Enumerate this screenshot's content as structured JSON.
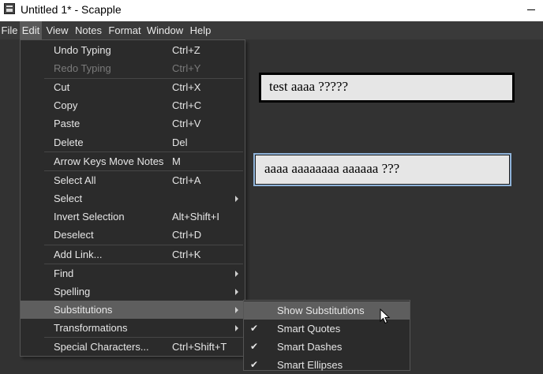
{
  "window": {
    "title": "Untitled 1* - Scapple"
  },
  "menubar": {
    "items": [
      {
        "label": "File"
      },
      {
        "label": "Edit"
      },
      {
        "label": "View"
      },
      {
        "label": "Notes"
      },
      {
        "label": "Format"
      },
      {
        "label": "Window"
      },
      {
        "label": "Help"
      }
    ]
  },
  "edit_menu": {
    "items": [
      {
        "label": "Undo Typing",
        "shortcut": "Ctrl+Z"
      },
      {
        "label": "Redo Typing",
        "shortcut": "Ctrl+Y",
        "disabled": true
      },
      {
        "label": "Cut",
        "shortcut": "Ctrl+X"
      },
      {
        "label": "Copy",
        "shortcut": "Ctrl+C"
      },
      {
        "label": "Paste",
        "shortcut": "Ctrl+V"
      },
      {
        "label": "Delete",
        "shortcut": "Del"
      },
      {
        "label": "Arrow Keys Move Notes",
        "shortcut": "M"
      },
      {
        "label": "Select All",
        "shortcut": "Ctrl+A"
      },
      {
        "label": "Select",
        "shortcut": "",
        "submenu": true
      },
      {
        "label": "Invert Selection",
        "shortcut": "Alt+Shift+I"
      },
      {
        "label": "Deselect",
        "shortcut": "Ctrl+D"
      },
      {
        "label": "Add Link...",
        "shortcut": "Ctrl+K"
      },
      {
        "label": "Find",
        "shortcut": "",
        "submenu": true
      },
      {
        "label": "Spelling",
        "shortcut": "",
        "submenu": true
      },
      {
        "label": "Substitutions",
        "shortcut": "",
        "submenu": true,
        "highlighted": true
      },
      {
        "label": "Transformations",
        "shortcut": "",
        "submenu": true
      },
      {
        "label": "Special Characters...",
        "shortcut": "Ctrl+Shift+T"
      }
    ]
  },
  "substitutions_menu": {
    "items": [
      {
        "label": "Show Substitutions",
        "checked": false,
        "highlighted": true
      },
      {
        "label": "Smart Quotes",
        "checked": true
      },
      {
        "label": "Smart Dashes",
        "checked": true
      },
      {
        "label": "Smart Ellipses",
        "checked": true
      }
    ]
  },
  "notes": [
    {
      "text": "test  aaaa ?????"
    },
    {
      "text": "aaaa aaaaaaaa aaaaaa ???"
    }
  ],
  "icons": {
    "app": "scapple-app-icon",
    "minimize": "minimize-icon",
    "submenu_arrow": "chevron-right-icon",
    "check": "checkmark-icon",
    "cursor": "mouse-pointer-icon"
  },
  "colors": {
    "canvas": "#323232",
    "menu_bg": "#2b2b2b",
    "highlight": "#5e5e5e",
    "note_bg": "#e6e6e6",
    "selected_note_outline": "#8fb3d9"
  }
}
